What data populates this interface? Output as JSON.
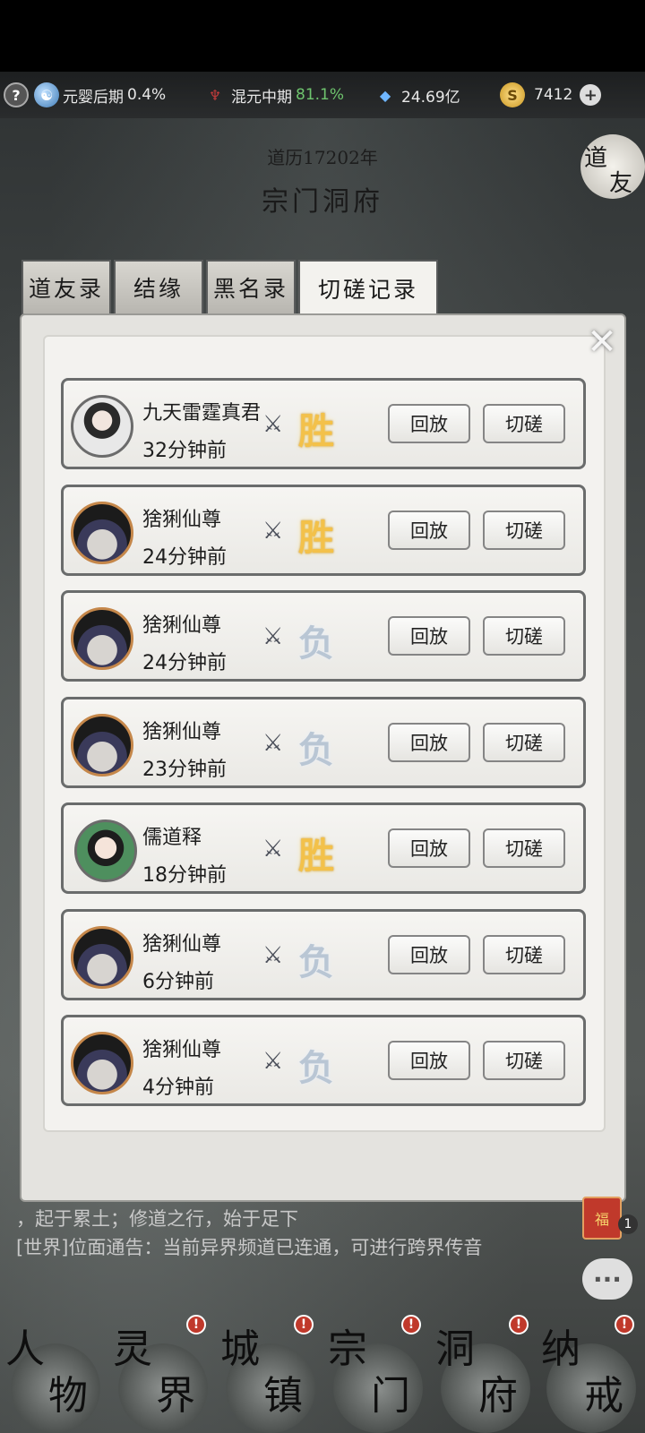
{
  "resources": {
    "realm1_name": "元婴后期",
    "realm1_percent": "0.4%",
    "realm2_name": "混元中期",
    "realm2_percent": "81.1%",
    "crystals": "24.69亿",
    "coins": "7412"
  },
  "header": {
    "year": "道历17202年",
    "title": "宗门洞府",
    "side_button_char1": "道",
    "side_button_char2": "友"
  },
  "tabs": [
    "道友录",
    "结缘",
    "黑名录",
    "切磋记录"
  ],
  "records": [
    {
      "name": "九天雷霆真君",
      "time": "32分钟前",
      "result": "胜",
      "replay": "回放",
      "spar": "切磋"
    },
    {
      "name": "猞猁仙尊",
      "time": "24分钟前",
      "result": "胜",
      "replay": "回放",
      "spar": "切磋"
    },
    {
      "name": "猞猁仙尊",
      "time": "24分钟前",
      "result": "负",
      "replay": "回放",
      "spar": "切磋"
    },
    {
      "name": "猞猁仙尊",
      "time": "23分钟前",
      "result": "负",
      "replay": "回放",
      "spar": "切磋"
    },
    {
      "name": "儒道释",
      "time": "18分钟前",
      "result": "胜",
      "replay": "回放",
      "spar": "切磋"
    },
    {
      "name": "猞猁仙尊",
      "time": "6分钟前",
      "result": "负",
      "replay": "回放",
      "spar": "切磋"
    },
    {
      "name": "猞猁仙尊",
      "time": "4分钟前",
      "result": "负",
      "replay": "回放",
      "spar": "切磋"
    }
  ],
  "chat": {
    "line1": "，起于累土；修道之行，始于足下",
    "line2_tag": "[世界]",
    "line2": "位面通告：当前异界频道已连通，可进行跨界传音"
  },
  "side": {
    "fu_label": "福",
    "fu_count": "1"
  },
  "nav": [
    {
      "c1": "人",
      "c2": "物",
      "badge": ""
    },
    {
      "c1": "灵",
      "c2": "界",
      "badge": "!"
    },
    {
      "c1": "城",
      "c2": "镇",
      "badge": "!"
    },
    {
      "c1": "宗",
      "c2": "门",
      "badge": "!"
    },
    {
      "c1": "洞",
      "c2": "府",
      "badge": "!"
    },
    {
      "c1": "纳",
      "c2": "戒",
      "badge": "!"
    }
  ],
  "colors": {
    "win": "#f3c14a",
    "lose": "#b9c6d4",
    "progress_green": "#6ec46e"
  }
}
